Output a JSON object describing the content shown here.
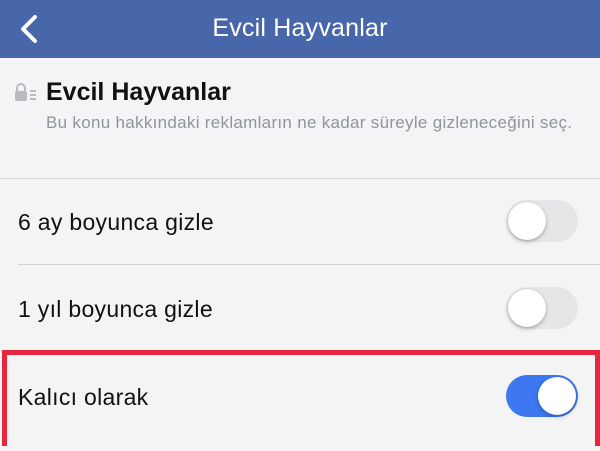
{
  "nav": {
    "title": "Evcil Hayvanlar",
    "back_icon": "chevron-left-icon",
    "background_color": "#4867aa"
  },
  "header": {
    "lock_icon": "lock-icon",
    "title": "Evcil Hayvanlar",
    "description": "Bu konu hakkındaki reklamların ne kadar süreyle gizleneceğini seç."
  },
  "options": [
    {
      "label": "6 ay boyunca gizle",
      "enabled": false
    },
    {
      "label": "1 yıl boyunca gizle",
      "enabled": false
    },
    {
      "label": "Kalıcı olarak",
      "enabled": true
    }
  ],
  "colors": {
    "toggle_on": "#3d78f1",
    "toggle_off": "#e6e6e8",
    "highlight": "#e8253f"
  }
}
